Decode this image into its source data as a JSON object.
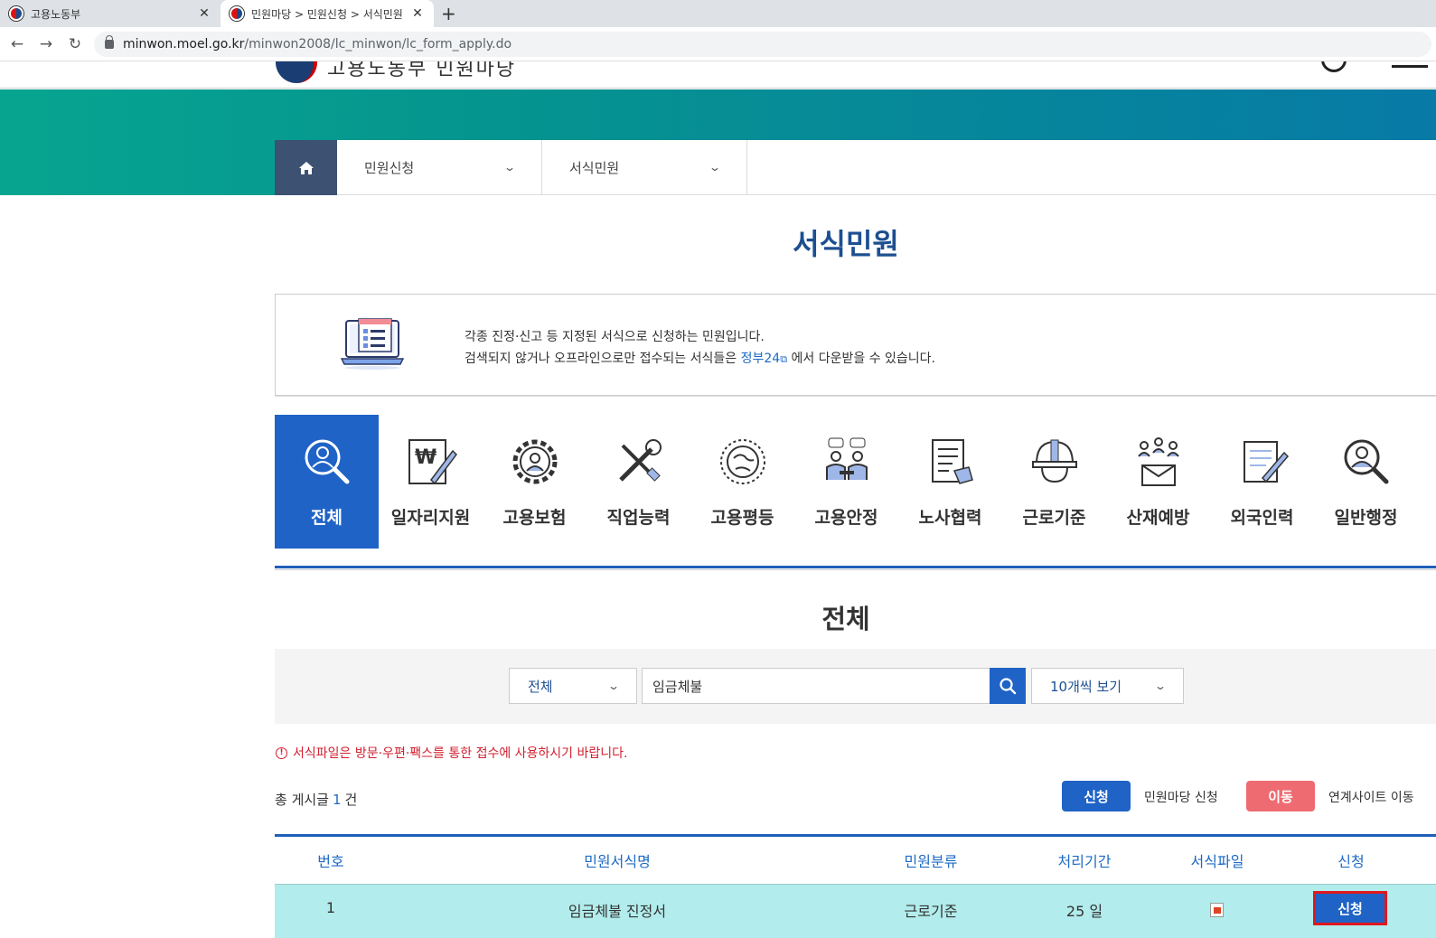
{
  "browser": {
    "tabs": [
      {
        "title": "고용노동부",
        "active": false
      },
      {
        "title": "민원마당 > 민원신청 > 서식민원",
        "active": true
      }
    ],
    "url_host": "minwon.moel.go.kr",
    "url_path": "/minwon2008/lc_minwon/lc_form_apply.do"
  },
  "header": {
    "logo_text": "고용노동부 민원마당"
  },
  "breadcrumb": {
    "home_icon": "home-icon",
    "item1": "민원신청",
    "item2": "서식민원"
  },
  "page": {
    "title": "서식민원",
    "info_line1": "각종 진정·신고 등 지정된 서식으로 신청하는 민원입니다.",
    "info_line2_prefix": "검색되지 않거나 오프라인으로만 접수되는 서식들은",
    "info_link": "정부24",
    "info_line2_suffix": "에서 다운받을 수 있습니다."
  },
  "categories": [
    {
      "label": "전체",
      "icon": "search-person-icon",
      "active": true
    },
    {
      "label": "일자리지원",
      "icon": "won-document-icon",
      "active": false
    },
    {
      "label": "고용보험",
      "icon": "gear-person-icon",
      "active": false
    },
    {
      "label": "직업능력",
      "icon": "tools-icon",
      "active": false
    },
    {
      "label": "고용평등",
      "icon": "globe-icon",
      "active": false
    },
    {
      "label": "고용안정",
      "icon": "meeting-icon",
      "active": false
    },
    {
      "label": "노사협력",
      "icon": "document-hand-icon",
      "active": false
    },
    {
      "label": "근로기준",
      "icon": "helmet-icon",
      "active": false
    },
    {
      "label": "산재예방",
      "icon": "mail-people-icon",
      "active": false
    },
    {
      "label": "외국인력",
      "icon": "document-pen-icon",
      "active": false
    },
    {
      "label": "일반행정",
      "icon": "search-person-icon",
      "active": false
    }
  ],
  "section_title": "전체",
  "search": {
    "scope_selected": "전체",
    "query": "임금체불",
    "page_size_selected": "10개씩 보기"
  },
  "notice": "서식파일은 방문·우편·팩스를 통한 접수에 사용하시기 바랍니다.",
  "summary": {
    "total_prefix": "총 게시글",
    "total_count": "1",
    "total_suffix": "건",
    "apply_button": "신청",
    "apply_label": "민원마당 신청",
    "move_button": "이동",
    "move_label": "연계사이트 이동"
  },
  "table": {
    "headers": [
      "번호",
      "민원서식명",
      "민원분류",
      "처리기간",
      "서식파일",
      "신청"
    ],
    "rows": [
      {
        "no": "1",
        "name": "임금체불 진정서",
        "category": "근로기준",
        "period": "25 일",
        "file_icon": "hwp-file-icon",
        "action": "신청"
      }
    ]
  },
  "colors": {
    "primary_blue": "#1f63c6",
    "title_blue": "#1d4f91",
    "move_red": "#ef6b72",
    "notice_red": "#d21f2f",
    "row_highlight": "#b2ecec",
    "banner_start": "#07a590",
    "banner_end": "#077aa6"
  }
}
